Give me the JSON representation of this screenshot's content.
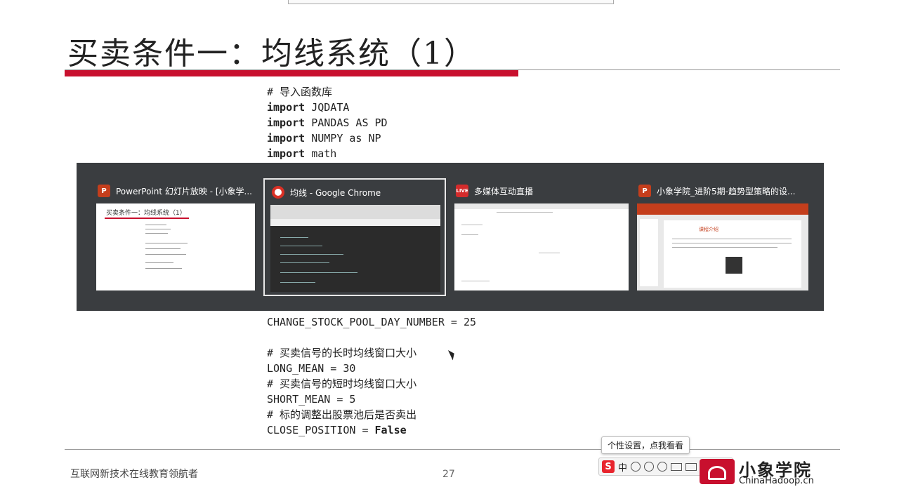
{
  "slide": {
    "title": "买卖条件一：均线系统（1）",
    "code_top": [
      {
        "type": "comment",
        "text": "# 导入函数库"
      },
      {
        "type": "import",
        "kw": "import",
        "rest": " JQDATA"
      },
      {
        "type": "import",
        "kw": "import",
        "rest": " PANDAS AS PD"
      },
      {
        "type": "import",
        "kw": "import",
        "rest": " NUMPY as NP"
      },
      {
        "type": "import",
        "kw": "import",
        "rest": " math"
      }
    ],
    "code_bottom": [
      {
        "type": "plain",
        "text": "CHANGE_STOCK_POOL_DAY_NUMBER = 25"
      },
      {
        "type": "plain",
        "text": ""
      },
      {
        "type": "comment",
        "text": "# 买卖信号的长时均线窗口大小"
      },
      {
        "type": "plain",
        "text": "LONG_MEAN = 30"
      },
      {
        "type": "comment",
        "text": "# 买卖信号的短时均线窗口大小"
      },
      {
        "type": "plain",
        "text": "SHORT_MEAN = 5"
      },
      {
        "type": "comment",
        "text": "# 标的调整出股票池后是否卖出"
      },
      {
        "type": "close",
        "kw_left": "CLOSE_POSITION = ",
        "kw": "False"
      }
    ],
    "footer_text": "互联网新技术在线教育领航者",
    "page_number": "27",
    "logo_cn": "小象学院",
    "logo_en": "ChinaHadoop.cn"
  },
  "ime": {
    "tooltip": "个性设置，点我看看",
    "s_label": "S",
    "mode": "中"
  },
  "switcher": {
    "windows": [
      {
        "title": "PowerPoint 幻灯片放映 - [小象学...",
        "icon": "powerpoint-icon",
        "thumb_title": "买卖条件一：均线系统（1）",
        "selected": false
      },
      {
        "title": "均线 - Google Chrome",
        "icon": "chrome-icon",
        "selected": true
      },
      {
        "title": "多媒体互动直播",
        "icon": "live-icon",
        "icon_text": "LIVE",
        "selected": false
      },
      {
        "title": "小象学院_进阶5期-趋势型策略的设...",
        "icon": "powerpoint-icon",
        "thumb_title": "课程介绍",
        "selected": false
      }
    ]
  },
  "colors": {
    "accent_red": "#c8102e",
    "switcher_bg": "#3a3d40"
  }
}
